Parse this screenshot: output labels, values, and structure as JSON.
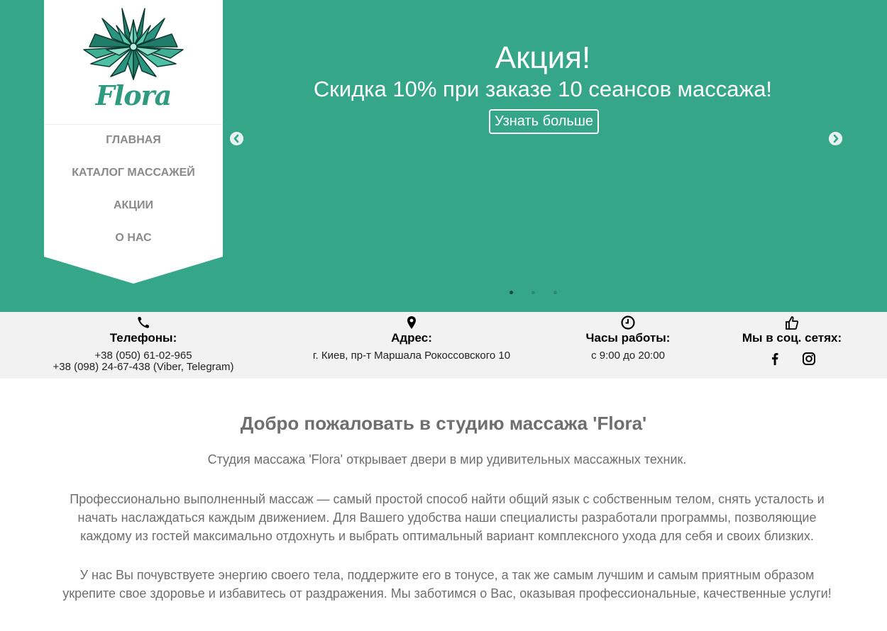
{
  "hero": {
    "title": "Акция!",
    "subtitle": "Скидка 10% при заказе 10 сеансов массажа!",
    "button_label": "Узнать больше",
    "prev_arrow": "chevron-left-icon",
    "next_arrow": "chevron-right-icon",
    "slide_count": 3,
    "active_slide": 1,
    "bg_color": "#35a68a"
  },
  "brand": {
    "name": "Flora",
    "color": "#2e9a80"
  },
  "nav": {
    "items": [
      {
        "label": "ГЛАВНАЯ"
      },
      {
        "label": "КАТАЛОГ МАССАЖЕЙ"
      },
      {
        "label": "АКЦИИ"
      },
      {
        "label": "О НАС"
      }
    ]
  },
  "info": {
    "phones": {
      "icon": "phone-icon",
      "title": "Телефоны:",
      "line1": "+38 (050) 61-02-965",
      "line2": "+38 (098) 24-67-438 (Viber, Telegram)"
    },
    "address": {
      "icon": "map-pin-icon",
      "title": "Адрес:",
      "text": "г. Киев, пр-т Маршала Рокоссовского 10"
    },
    "hours": {
      "icon": "clock-icon",
      "title": "Часы работы:",
      "text": "с 9:00 до 20:00"
    },
    "social": {
      "icon": "thumbs-up-icon",
      "title": "Мы в соц. сетях:",
      "links": [
        "facebook-icon",
        "instagram-icon"
      ]
    }
  },
  "content": {
    "heading": "Добро пожаловать в студию массажа 'Flora'",
    "para1": "Студия массажа 'Flora' открывает двери в мир удивительных массажных техник.",
    "para2": "Профессионально выполненный массаж — самый простой способ найти общий язык с собственным телом, снять усталость и начать наслаждаться каждым движением. Для Вашего удобства наши специалисты разработали программы, позволяющие каждому из гостей максимально отдохнуть и выбрать оптимальный вариант комплексного ухода для себя и своих близких.",
    "para3": "У нас Вы почувствуете энергию своего тела, поддержите его в тонусе, а так же самым лучшим и самым приятным образом укрепите свое здоровье и избавитесь от раздражения. Мы заботимся о Вас, оказывая профессиональные, качественные услуги!"
  }
}
